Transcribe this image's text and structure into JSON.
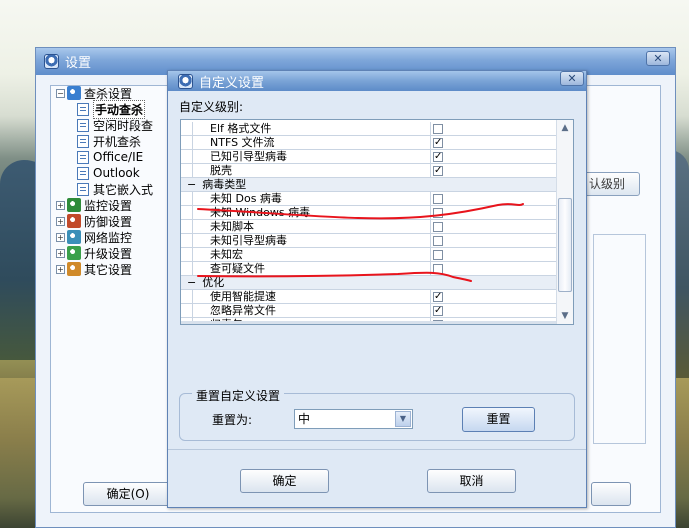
{
  "outer_window": {
    "title": "设置",
    "tree": [
      {
        "label": "查杀设置",
        "level": 0,
        "expander": "−"
      },
      {
        "label": "手动查杀",
        "level": 1
      },
      {
        "label": "空闲时段查",
        "level": 1
      },
      {
        "label": "开机查杀",
        "level": 1
      },
      {
        "label": "Office/IE",
        "level": 1
      },
      {
        "label": "Outlook",
        "level": 1
      },
      {
        "label": "其它嵌入式",
        "level": 1
      },
      {
        "label": "监控设置",
        "level": 0,
        "expander": "+"
      },
      {
        "label": "防御设置",
        "level": 0,
        "expander": "+"
      },
      {
        "label": "网络监控",
        "level": 0,
        "expander": "+"
      },
      {
        "label": "升级设置",
        "level": 0,
        "expander": "+"
      },
      {
        "label": "其它设置",
        "level": 0,
        "expander": "+"
      }
    ],
    "right_button": "认级别",
    "ok_button": "确定(O)"
  },
  "dialog": {
    "title": "自定义设置",
    "level_label": "自定义级别:",
    "list_rows": [
      {
        "type": "item",
        "label": "Elf 格式文件",
        "checked": false
      },
      {
        "type": "item",
        "label": "NTFS 文件流",
        "checked": true
      },
      {
        "type": "item",
        "label": "已知引导型病毒",
        "checked": true
      },
      {
        "type": "item",
        "label": "脱壳",
        "checked": true
      },
      {
        "type": "category",
        "label": "病毒类型",
        "sign": "−"
      },
      {
        "type": "item",
        "label": "未知 Dos 病毒",
        "checked": false
      },
      {
        "type": "item",
        "label": "未知 Windows 病毒",
        "checked": false
      },
      {
        "type": "item",
        "label": "未知脚本",
        "checked": false
      },
      {
        "type": "item",
        "label": "未知引导型病毒",
        "checked": false
      },
      {
        "type": "item",
        "label": "未知宏",
        "checked": false
      },
      {
        "type": "item",
        "label": "查可疑文件",
        "checked": false
      },
      {
        "type": "category",
        "label": "优化",
        "sign": "−"
      },
      {
        "type": "item",
        "label": "使用智能提速",
        "checked": true
      },
      {
        "type": "item",
        "label": "忽略异常文件",
        "checked": true
      },
      {
        "type": "item",
        "label": "归毒包",
        "checked": false
      }
    ],
    "reset_group_title": "重置自定义设置",
    "reset_label": "重置为:",
    "reset_value": "中",
    "reset_button": "重置",
    "ok_button": "确定",
    "cancel_button": "取消",
    "annotation_color": "#e8141c"
  }
}
